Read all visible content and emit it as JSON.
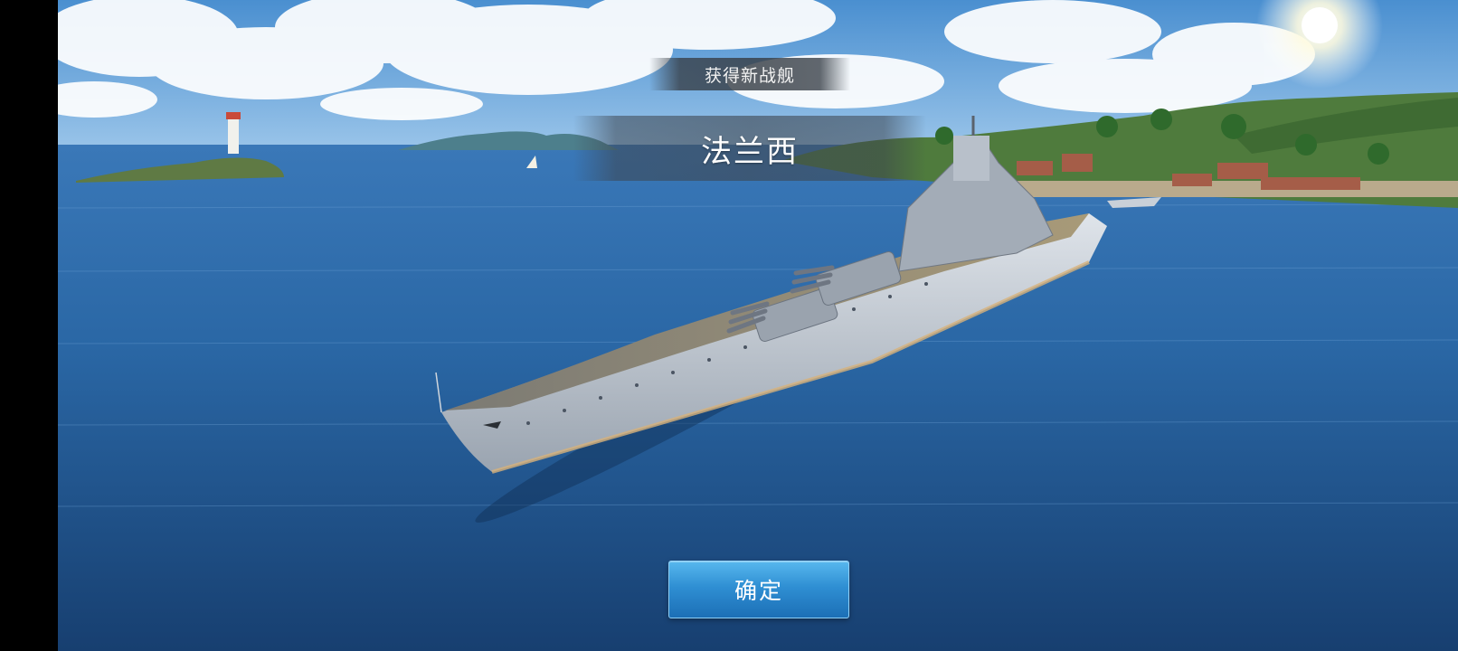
{
  "dialog": {
    "subtitle": "获得新战舰",
    "ship_name": "法兰西"
  },
  "actions": {
    "confirm_label": "确定"
  },
  "colors": {
    "button_primary": "#2f8fd3",
    "banner_bg": "#373e46",
    "sky": "#6aa7dc",
    "sea": "#1e5a94"
  }
}
